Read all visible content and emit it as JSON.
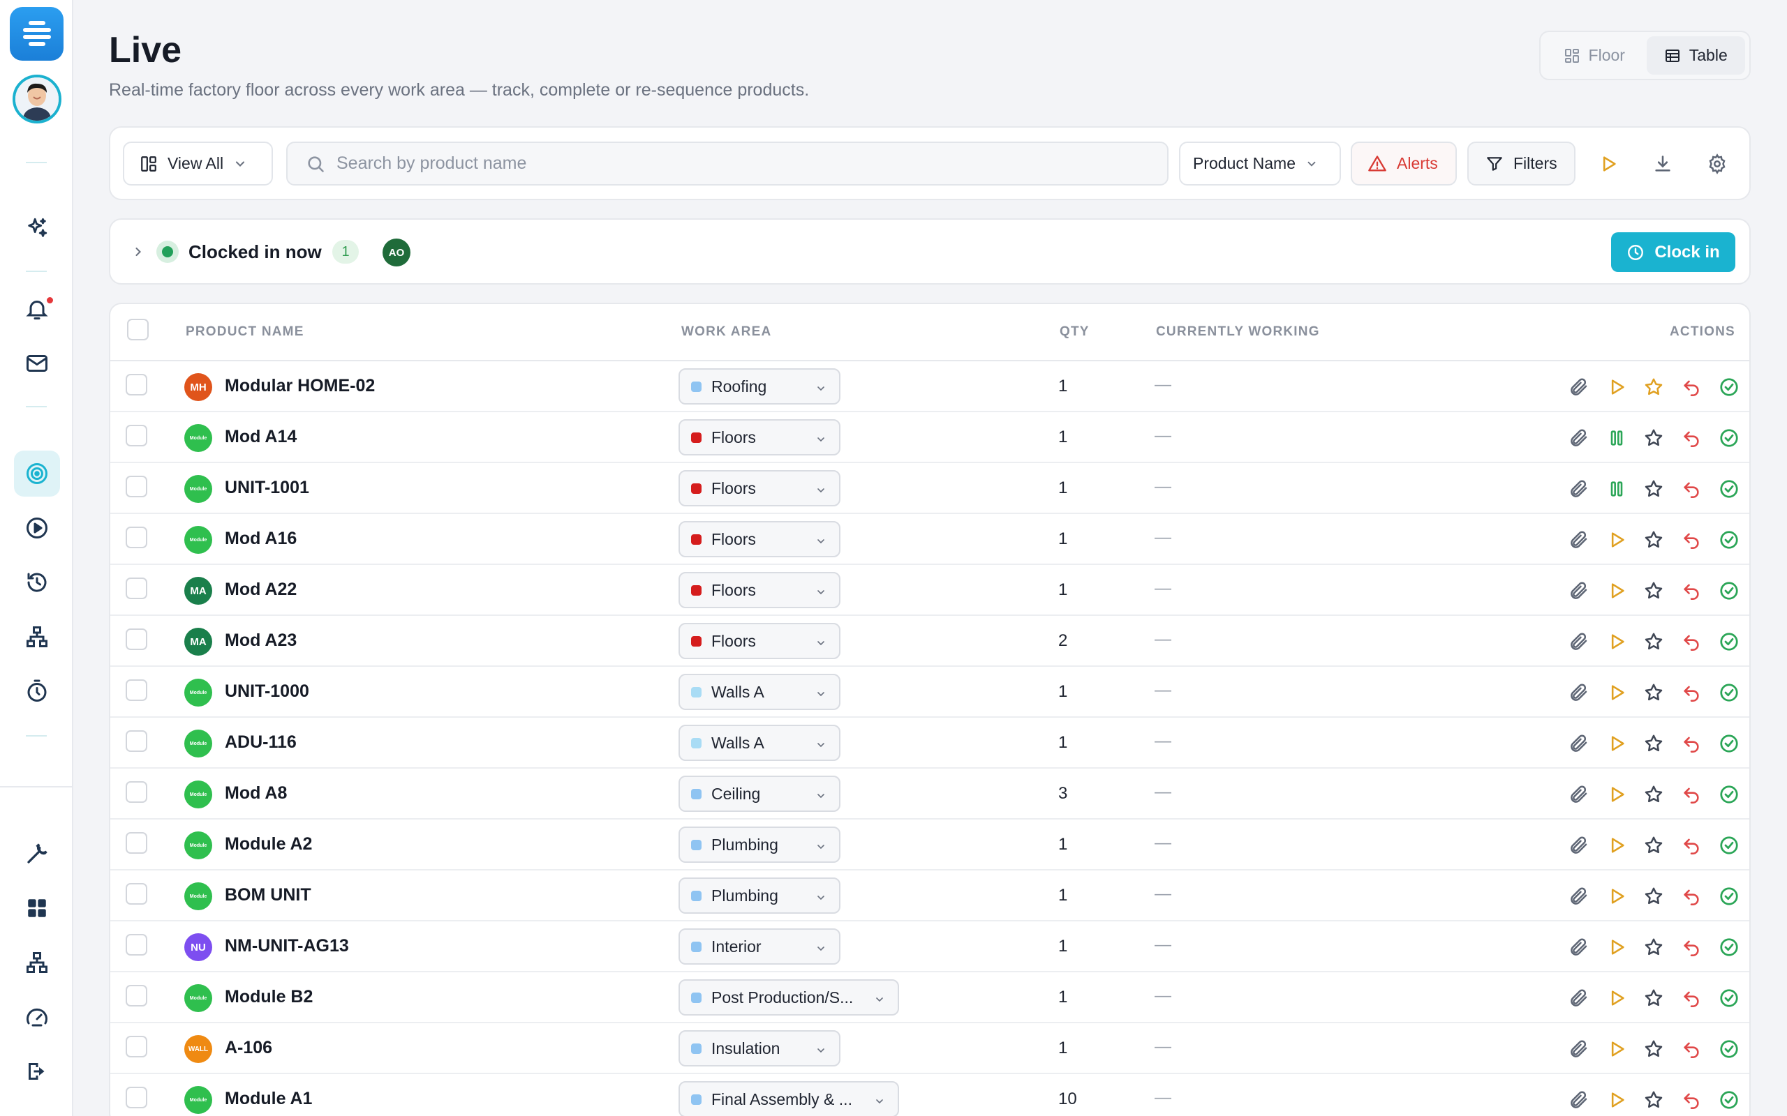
{
  "sidebar": {
    "logo_icon": "app-logo-icon",
    "avatar_icon": "user-avatar",
    "items": [
      {
        "name": "ai-sparkle-icon"
      },
      {
        "name": "bell-icon"
      },
      {
        "name": "mail-icon"
      },
      {
        "name": "target-icon",
        "active": true
      },
      {
        "name": "play-circle-icon"
      },
      {
        "name": "history-icon"
      },
      {
        "name": "network-icon"
      },
      {
        "name": "stopwatch-icon"
      },
      {
        "name": "wrench-icon"
      },
      {
        "name": "grid-icon"
      },
      {
        "name": "network-icon"
      },
      {
        "name": "speedometer-icon"
      },
      {
        "name": "logout-icon"
      }
    ]
  },
  "header": {
    "title": "Live",
    "subtitle": "Real-time factory floor across every work area — track, complete or re-sequence products.",
    "view_toggle": {
      "floor": "Floor",
      "table": "Table",
      "active": "Table"
    }
  },
  "toolbar": {
    "view_all": "View All",
    "search_placeholder": "Search by product name",
    "search_value": "",
    "sort_field": "Product Name",
    "alerts": "Alerts",
    "filters": "Filters"
  },
  "clocked_in": {
    "label": "Clocked in now",
    "count": "1",
    "avatars": [
      "AO"
    ],
    "button": "Clock in"
  },
  "table": {
    "columns": {
      "product_name": "PRODUCT NAME",
      "work_area": "WORK AREA",
      "qty": "QTY",
      "currently_working": "CURRENTLY WORKING",
      "actions": "ACTIONS"
    },
    "rows": [
      {
        "avatar": "MH",
        "avatar_color": "#e0541b",
        "name": "Modular HOME-02",
        "work_area": "Roofing",
        "area_color": "#8fc4f2",
        "qty": "1",
        "working": "—",
        "status": "play",
        "starred": true
      },
      {
        "avatar": "Module",
        "avatar_color": "#2fbf4e",
        "name": "Mod A14",
        "work_area": "Floors",
        "area_color": "#d51d1d",
        "qty": "1",
        "working": "—",
        "status": "pause",
        "starred": false
      },
      {
        "avatar": "Module",
        "avatar_color": "#2fbf4e",
        "name": "UNIT-1001",
        "work_area": "Floors",
        "area_color": "#d51d1d",
        "qty": "1",
        "working": "—",
        "status": "pause",
        "starred": false
      },
      {
        "avatar": "Module",
        "avatar_color": "#2fbf4e",
        "name": "Mod A16",
        "work_area": "Floors",
        "area_color": "#d51d1d",
        "qty": "1",
        "working": "—",
        "status": "play",
        "starred": false
      },
      {
        "avatar": "MA",
        "avatar_color": "#1a7f4b",
        "name": "Mod A22",
        "work_area": "Floors",
        "area_color": "#d51d1d",
        "qty": "1",
        "working": "—",
        "status": "play",
        "starred": false
      },
      {
        "avatar": "MA",
        "avatar_color": "#1a7f4b",
        "name": "Mod A23",
        "work_area": "Floors",
        "area_color": "#d51d1d",
        "qty": "2",
        "working": "—",
        "status": "play",
        "starred": false
      },
      {
        "avatar": "Module",
        "avatar_color": "#2fbf4e",
        "name": "UNIT-1000",
        "work_area": "Walls A",
        "area_color": "#a9dcf5",
        "qty": "1",
        "working": "—",
        "status": "play",
        "starred": false
      },
      {
        "avatar": "Module",
        "avatar_color": "#2fbf4e",
        "name": "ADU-116",
        "work_area": "Walls A",
        "area_color": "#a9dcf5",
        "qty": "1",
        "working": "—",
        "status": "play",
        "starred": false
      },
      {
        "avatar": "Module",
        "avatar_color": "#2fbf4e",
        "name": "Mod A8",
        "work_area": "Ceiling",
        "area_color": "#8fc4f2",
        "qty": "3",
        "working": "—",
        "status": "play",
        "starred": false
      },
      {
        "avatar": "Module",
        "avatar_color": "#2fbf4e",
        "name": "Module A2",
        "work_area": "Plumbing",
        "area_color": "#8fc4f2",
        "qty": "1",
        "working": "—",
        "status": "play",
        "starred": false
      },
      {
        "avatar": "Module",
        "avatar_color": "#2fbf4e",
        "name": "BOM UNIT",
        "work_area": "Plumbing",
        "area_color": "#8fc4f2",
        "qty": "1",
        "working": "—",
        "status": "play",
        "starred": false
      },
      {
        "avatar": "NU",
        "avatar_color": "#7d4ef0",
        "name": "NM-UNIT-AG13",
        "work_area": "Interior",
        "area_color": "#8fc4f2",
        "qty": "1",
        "working": "—",
        "status": "play",
        "starred": false
      },
      {
        "avatar": "Module",
        "avatar_color": "#2fbf4e",
        "name": "Module B2",
        "work_area": "Post Production/S...",
        "area_color": "#8fc4f2",
        "qty": "1",
        "working": "—",
        "status": "play",
        "starred": false
      },
      {
        "avatar": "WALL",
        "avatar_color": "#ef8a12",
        "name": "A-106",
        "work_area": "Insulation",
        "area_color": "#8fc4f2",
        "qty": "1",
        "working": "—",
        "status": "play",
        "starred": false
      },
      {
        "avatar": "Module",
        "avatar_color": "#2fbf4e",
        "name": "Module A1",
        "work_area": "Final Assembly & ...",
        "area_color": "#8fc4f2",
        "qty": "10",
        "working": "—",
        "status": "play",
        "starred": false
      }
    ]
  },
  "colors": {
    "accent": "#1ab3d0",
    "alert": "#d83a34",
    "play": "#e0a020",
    "pause": "#2aa556",
    "complete": "#2aa556",
    "undo": "#e04848"
  }
}
